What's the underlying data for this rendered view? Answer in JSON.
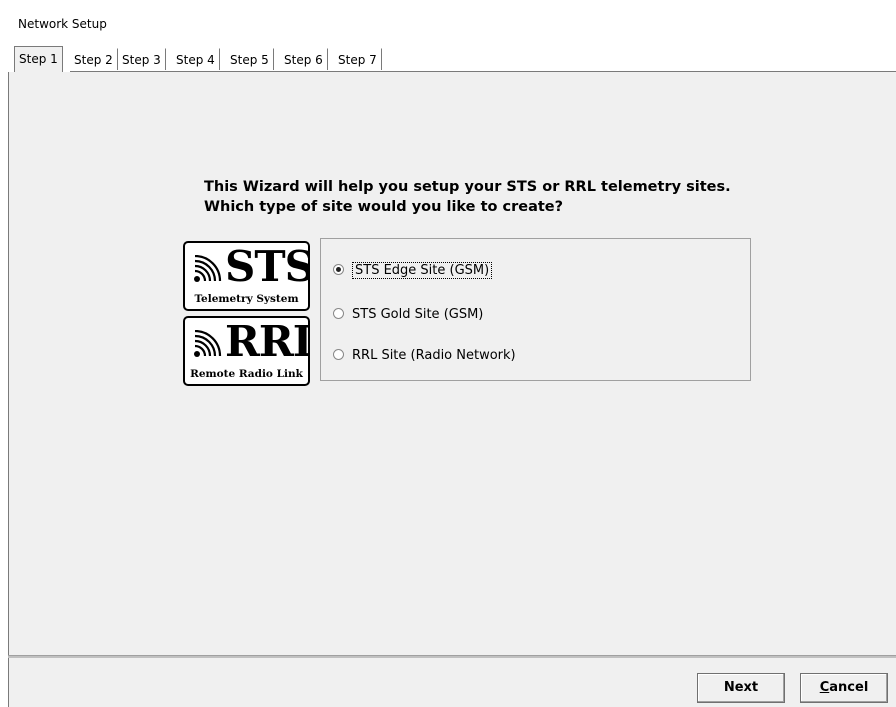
{
  "window": {
    "title": "Network Setup"
  },
  "tabs": [
    {
      "label": "Step 1",
      "active": true
    },
    {
      "label": "Step 2",
      "active": false
    },
    {
      "label": "Step 3",
      "active": false
    },
    {
      "label": "Step 4",
      "active": false
    },
    {
      "label": "Step 5",
      "active": false
    },
    {
      "label": "Step 6",
      "active": false
    },
    {
      "label": "Step 7",
      "active": false
    }
  ],
  "main": {
    "heading_line1": "This Wizard will help you setup your STS or RRL telemetry sites.",
    "heading_line2": "Which type of site would you like to create?",
    "logos": {
      "sts": {
        "big": "STS",
        "small": "Telemetry System"
      },
      "rrl": {
        "big": "RRL",
        "small": "Remote Radio Link"
      }
    },
    "options": [
      {
        "label": "STS Edge Site (GSM)",
        "selected": true
      },
      {
        "label": "STS Gold Site (GSM)",
        "selected": false
      },
      {
        "label": "RRL Site (Radio Network)",
        "selected": false
      }
    ]
  },
  "footer": {
    "next_label": "Next",
    "cancel_first": "C",
    "cancel_rest": "ancel"
  }
}
